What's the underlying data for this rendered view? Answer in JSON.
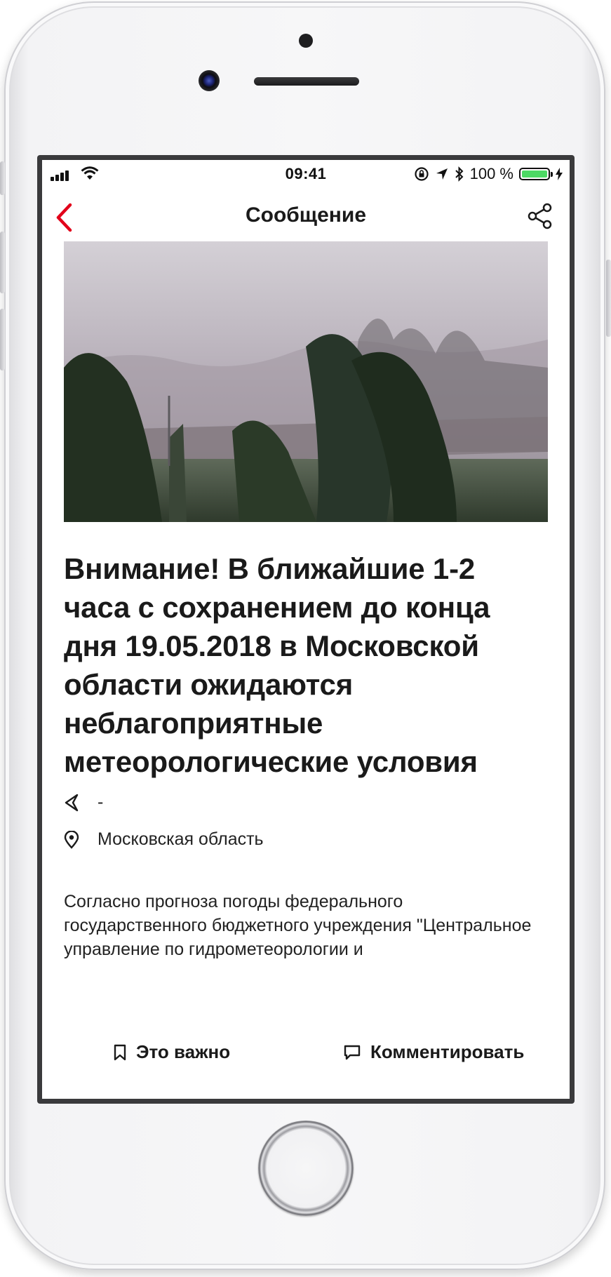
{
  "status_bar": {
    "time": "09:41",
    "battery_percent": "100 %"
  },
  "nav": {
    "title": "Сообщение"
  },
  "article": {
    "headline": "Внимание! В ближайшие 1-2 часа с сохранением до конца дня 19.05.2018 в Московской области ожидаются неблагоприятные метеорологические условия",
    "source": "-",
    "location": "Московская область",
    "body": "Согласно прогноза погоды федерального государственного бюджетного учреждения \"Центральное управление по гидрометеорологии и"
  },
  "actions": {
    "important_label": "Это важно",
    "comment_label": "Комментировать"
  },
  "colors": {
    "accent": "#e2001a",
    "battery": "#4cd964"
  }
}
